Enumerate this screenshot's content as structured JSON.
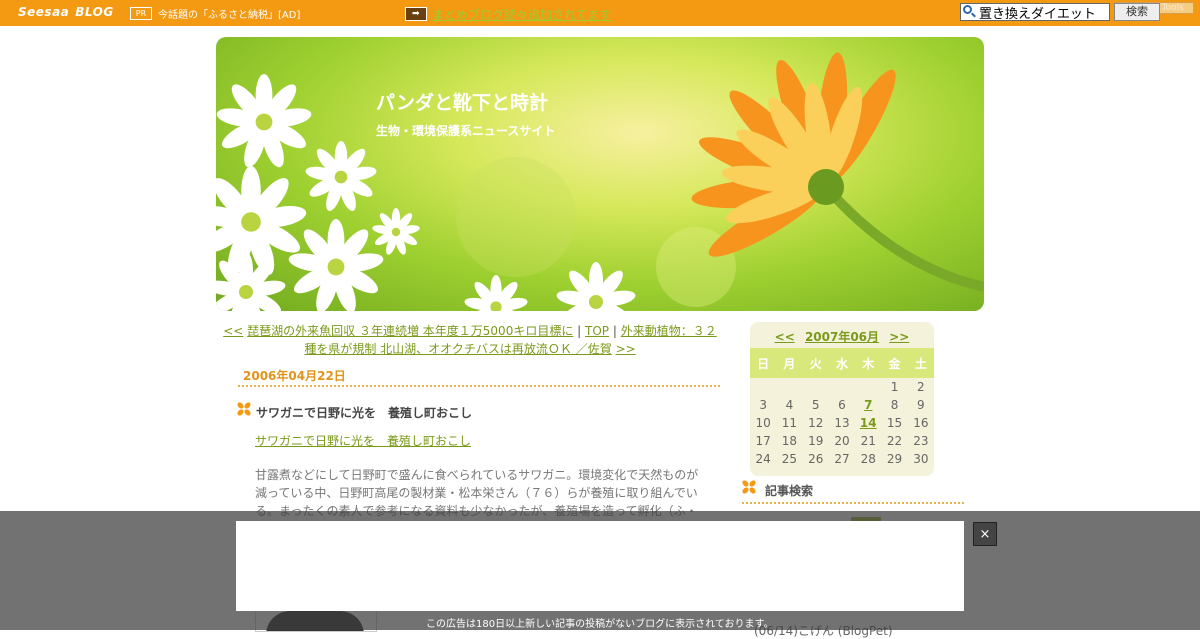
{
  "topbar": {
    "logo": "Seesaa",
    "logo_sub": "BLOG",
    "pr_badge": "PR",
    "pr_text": "今話題の「ふるさと納税」[AD]",
    "matome_text": "まとめブログ続々追加されてます",
    "search_value": "置き換えダイエット",
    "search_button": "検索",
    "tools_label": "Seesaa Tools"
  },
  "header": {
    "title": "パンダと靴下と時計",
    "subtitle": "生物・環境保護系ニュースサイト"
  },
  "nav": {
    "prev_marker": "<<",
    "prev_title": "琵琶湖の外来魚回収 ３年連続増 本年度１万5000キロ目標に",
    "sep1": "|",
    "top": "TOP",
    "sep2": "|",
    "next_title": "外来動植物：３２種を県が規制 北山湖、オオクチバスは再放流ＯＫ ／佐賀",
    "next_marker": ">>"
  },
  "entry": {
    "date": "2006年04月22日",
    "title": "サワガニで日野に光を　養殖し町おこし",
    "link": "サワガニで日野に光を　養殖し町おこし",
    "body": "甘露煮などにして日野町で盛んに食べられているサワガニ。環境変化で天然ものが減っている中、日野町高尾の製材業・松本栄さん（７６）らが養殖に取り組んでいる。まったくの素人で参考になる資料も少なかったが、養殖場を造って孵化（ふ・"
  },
  "calendar": {
    "prev": "<<",
    "month": "2007年06月",
    "next": ">>",
    "weekdays": [
      "日",
      "月",
      "火",
      "水",
      "木",
      "金",
      "土"
    ],
    "weeks": [
      [
        "",
        "",
        "",
        "",
        "",
        "1",
        "2"
      ],
      [
        "3",
        "4",
        "5",
        "6",
        "7",
        "8",
        "9"
      ],
      [
        "10",
        "11",
        "12",
        "13",
        "14",
        "15",
        "16"
      ],
      [
        "17",
        "18",
        "19",
        "20",
        "21",
        "22",
        "23"
      ],
      [
        "24",
        "25",
        "26",
        "27",
        "28",
        "29",
        "30"
      ]
    ],
    "linked_days": [
      "7",
      "14"
    ]
  },
  "sidebar": {
    "search_title": "記事検索",
    "recent_item": "(06/14)こげん (BlogPet)"
  },
  "overlay": {
    "close_label": "×",
    "note": "この広告は180日以上新しい記事の投稿がないブログに表示されております。"
  },
  "colors": {
    "topbar": "#f39a12",
    "link": "#7a9a1a",
    "date": "#e0941c",
    "calendar_header": "#d8e87a"
  }
}
